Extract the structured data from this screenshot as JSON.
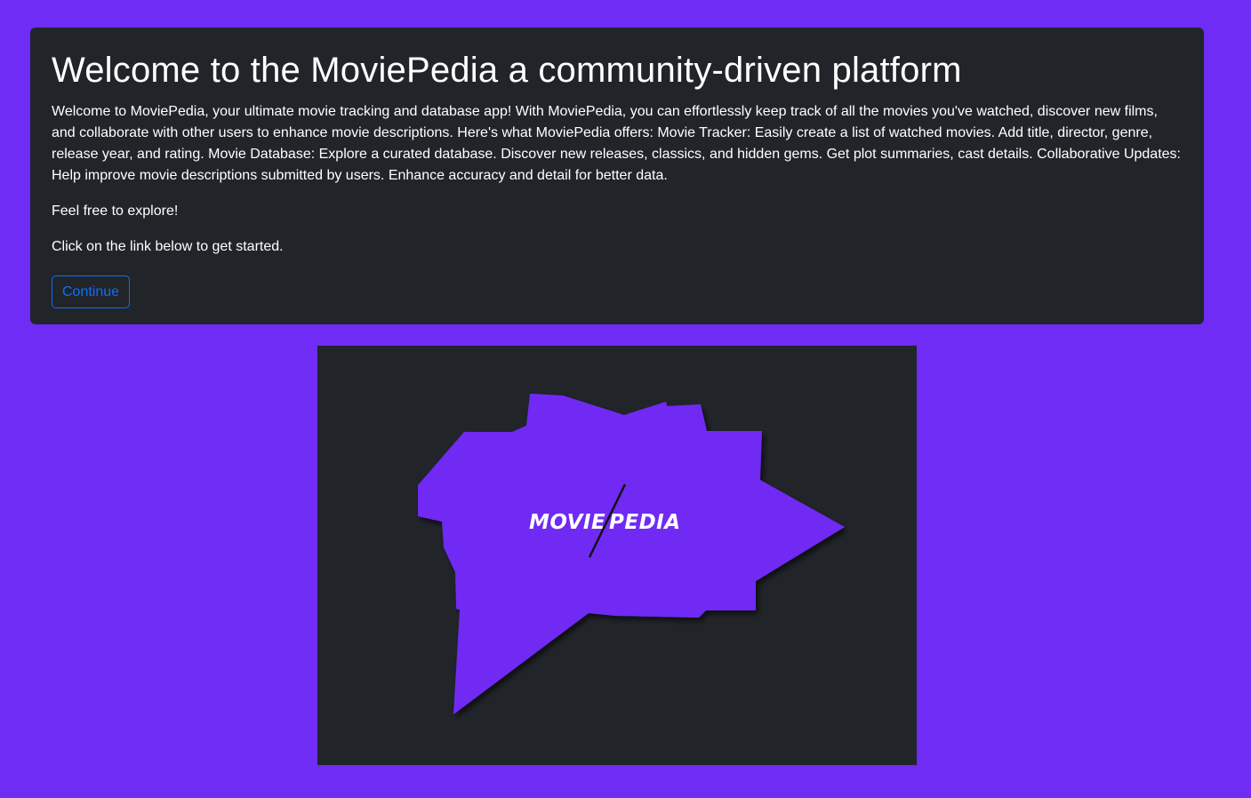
{
  "hero": {
    "title": "Welcome to the MoviePedia a community-driven platform",
    "description": "Welcome to MoviePedia, your ultimate movie tracking and database app! With MoviePedia, you can effortlessly keep track of all the movies you've watched, discover new films, and collaborate with other users to enhance movie descriptions. Here's what MoviePedia offers: Movie Tracker: Easily create a list of watched movies. Add title, director, genre, release year, and rating. Movie Database: Explore a curated database. Discover new releases, classics, and hidden gems. Get plot summaries, cast details. Collaborative Updates: Help improve movie descriptions submitted by users. Enhance accuracy and detail for better data.",
    "explore_text": "Feel free to explore!",
    "cta_text": "Click on the link below to get started.",
    "continue_label": "Continue"
  },
  "logo": {
    "left_word": "MOVIE",
    "right_word": "PEDIA"
  },
  "colors": {
    "page_background": "#6f2cf4",
    "card_background": "#212529",
    "button_outline": "#0d6efd",
    "logo_shape": "#6f2cf4"
  }
}
